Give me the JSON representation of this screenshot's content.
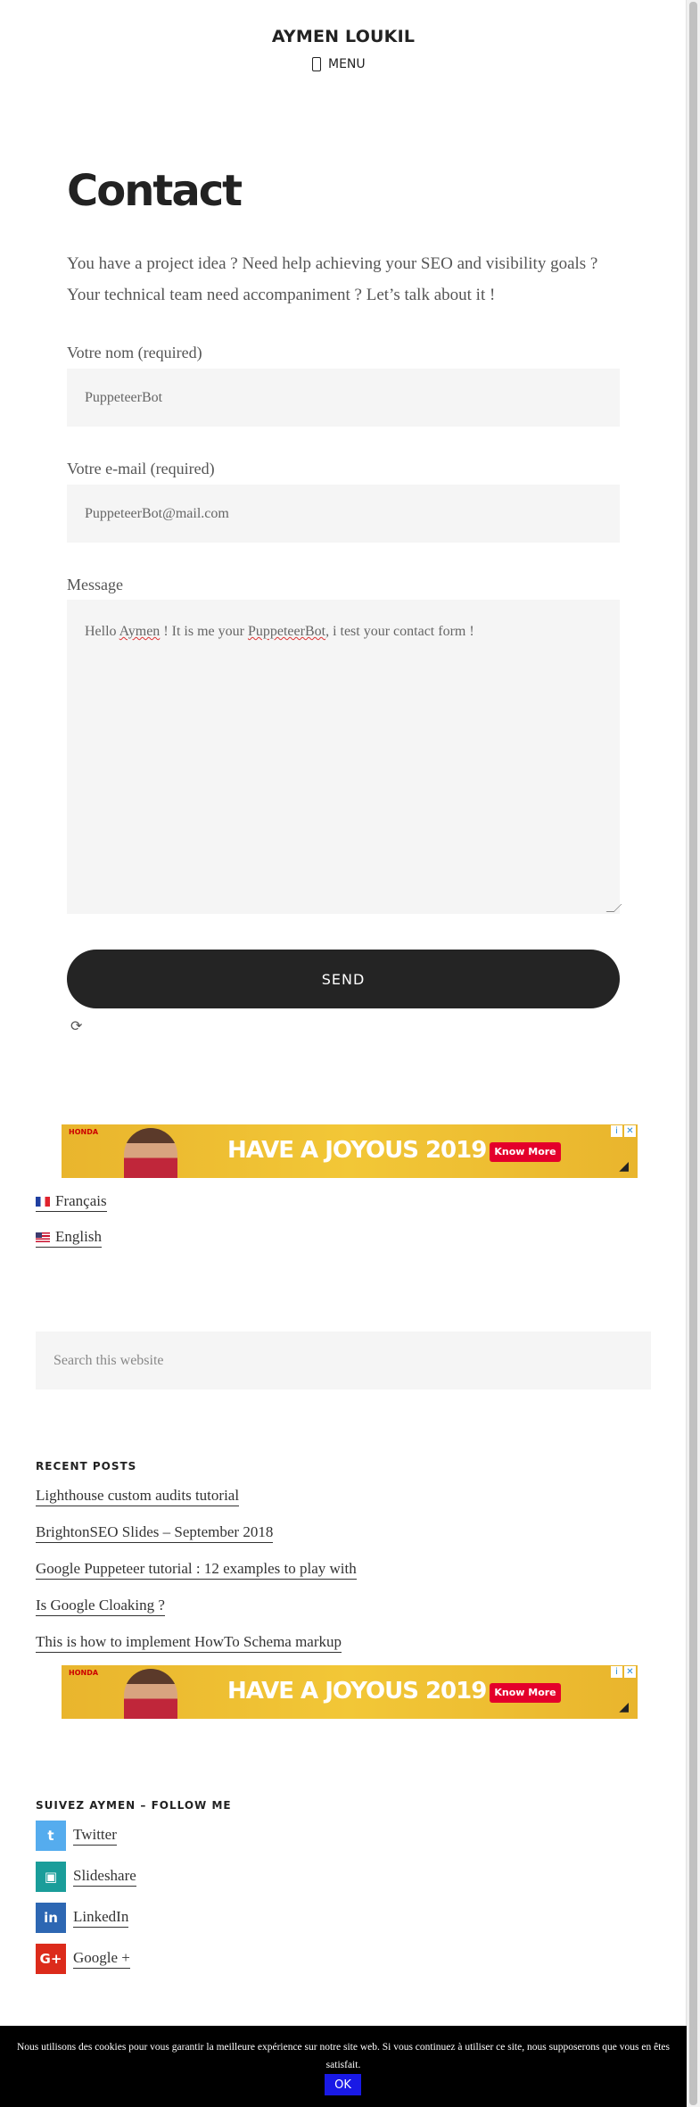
{
  "header": {
    "site_title": "AYMEN LOUKIL",
    "menu_label": "MENU"
  },
  "page": {
    "title": "Contact",
    "intro": "You have a project idea ? Need help achieving your SEO and visibility goals ? Your technical team need accompaniment ? Let’s talk about it !"
  },
  "form": {
    "name_label": "Votre nom (required)",
    "name_value": "PuppeteerBot",
    "email_label": "Votre e-mail (required)",
    "email_value": "PuppeteerBot@mail.com",
    "message_label": "Message",
    "message_parts": [
      "Hello ",
      "Aymen",
      " ! It is me your ",
      "PuppeteerBot",
      ", i test your contact form !"
    ],
    "send_label": "SEND"
  },
  "ads": [
    {
      "brand": "HONDA",
      "headline": "HAVE A JOYOUS 2019",
      "cta": "Know More"
    },
    {
      "brand": "HONDA",
      "headline": "HAVE A JOYOUS 2019",
      "cta": "Know More"
    }
  ],
  "languages": [
    {
      "label": "Français",
      "flag": "fr"
    },
    {
      "label": "English",
      "flag": "us"
    }
  ],
  "search": {
    "placeholder": "Search this website"
  },
  "recent_posts": {
    "title": "RECENT POSTS",
    "items": [
      "Lighthouse custom audits tutorial",
      "BrightonSEO Slides – September 2018",
      "Google Puppeteer tutorial : 12 examples to play with",
      "Is Google Cloaking ?",
      "This is how to implement HowTo Schema markup"
    ]
  },
  "follow": {
    "title": "SUIVEZ AYMEN – FOLLOW ME",
    "items": [
      {
        "label": "Twitter",
        "icon": "twitter-icon",
        "color": "#55acee"
      },
      {
        "label": "Slideshare",
        "icon": "slideshare-icon",
        "color": "#1a9d9a"
      },
      {
        "label": "LinkedIn",
        "icon": "linkedin-icon",
        "color": "#2d67b3"
      },
      {
        "label": "Google +",
        "icon": "google-plus-icon",
        "color": "#dc2b1b"
      }
    ]
  },
  "cookie": {
    "text": "Nous utilisons des cookies pour vous garantir la meilleure expérience sur notre site web. Si vous continuez à utiliser ce site, nous supposerons que vous en êtes satisfait.",
    "ok_label": "OK"
  }
}
